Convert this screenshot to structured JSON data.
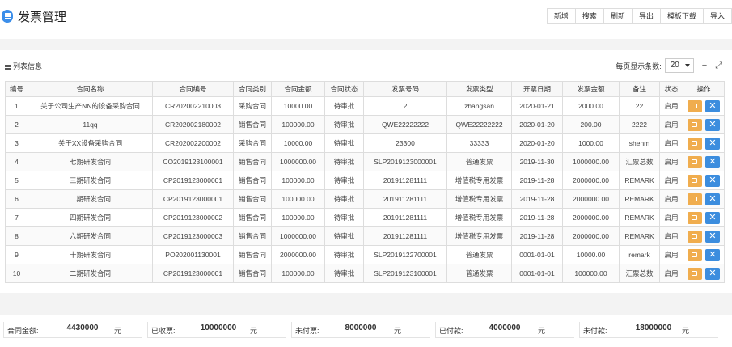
{
  "header": {
    "title": "发票管理"
  },
  "toolbar": {
    "buttons": [
      "新增",
      "搜索",
      "刷新",
      "导出",
      "模板下载",
      "导入"
    ]
  },
  "panel": {
    "title": "列表信息",
    "page_size_label": "每页显示条数:",
    "page_size_value": "20",
    "collapse_glyph": "−",
    "expand_glyph": "⤢"
  },
  "table": {
    "columns": [
      "编号",
      "合同名称",
      "合同编号",
      "合同类别",
      "合同金额",
      "合同状态",
      "发票号码",
      "发票类型",
      "开票日期",
      "发票金额",
      "备注",
      "状态",
      "操作"
    ],
    "rows": [
      [
        "1",
        "关于公司生产NN的设备采购合同",
        "CR202002210003",
        "采购合同",
        "10000.00",
        "待审批",
        "2",
        "zhangsan",
        "2020-01-21",
        "2000.00",
        "22",
        "启用"
      ],
      [
        "2",
        "11qq",
        "CR202002180002",
        "销售合同",
        "100000.00",
        "待审批",
        "QWE22222222",
        "QWE22222222",
        "2020-01-20",
        "200.00",
        "2222",
        "启用"
      ],
      [
        "3",
        "关于XX设备采购合同",
        "CR202002200002",
        "采购合同",
        "10000.00",
        "待审批",
        "23300",
        "33333",
        "2020-01-20",
        "1000.00",
        "shenm",
        "启用"
      ],
      [
        "4",
        "七期研发合同",
        "CO2019123100001",
        "销售合同",
        "1000000.00",
        "待审批",
        "SLP2019123000001",
        "普通发票",
        "2019-11-30",
        "1000000.00",
        "汇票总数",
        "启用"
      ],
      [
        "5",
        "三期研发合同",
        "CP2019123000001",
        "销售合同",
        "100000.00",
        "待审批",
        "201911281111",
        "增值税专用发票",
        "2019-11-28",
        "2000000.00",
        "REMARK",
        "启用"
      ],
      [
        "6",
        "二期研发合同",
        "CP2019123000001",
        "销售合同",
        "100000.00",
        "待审批",
        "201911281111",
        "增值税专用发票",
        "2019-11-28",
        "2000000.00",
        "REMARK",
        "启用"
      ],
      [
        "7",
        "四期研发合同",
        "CP2019123000002",
        "销售合同",
        "100000.00",
        "待审批",
        "201911281111",
        "增值税专用发票",
        "2019-11-28",
        "2000000.00",
        "REMARK",
        "启用"
      ],
      [
        "8",
        "六期研发合同",
        "CP2019123000003",
        "销售合同",
        "1000000.00",
        "待审批",
        "201911281111",
        "增值税专用发票",
        "2019-11-28",
        "2000000.00",
        "REMARK",
        "启用"
      ],
      [
        "9",
        "十期研发合同",
        "PO202001130001",
        "销售合同",
        "2000000.00",
        "待审批",
        "SLP2019122700001",
        "普通发票",
        "0001-01-01",
        "10000.00",
        "remark",
        "启用"
      ],
      [
        "10",
        "二期研发合同",
        "CP2019123000001",
        "销售合同",
        "100000.00",
        "待审批",
        "SLP2019123100001",
        "普通发票",
        "0001-01-01",
        "100000.00",
        "汇票总数",
        "启用"
      ]
    ]
  },
  "summary": [
    {
      "label": "合同金额:",
      "value": "4430000",
      "unit": "元"
    },
    {
      "label": "已收票:",
      "value": "10000000",
      "unit": "元"
    },
    {
      "label": "未付票:",
      "value": "8000000",
      "unit": "元"
    },
    {
      "label": "已付款:",
      "value": "4000000",
      "unit": "元"
    },
    {
      "label": "未付款:",
      "value": "18000000",
      "unit": "元"
    }
  ],
  "icons": {
    "menu": "menu-icon",
    "edit": "edit-icon",
    "delete": "delete-icon",
    "list": "list-icon"
  },
  "colors": {
    "accent": "#3b8eea",
    "edit": "#f0ad4e",
    "delete": "#3c8dde"
  }
}
